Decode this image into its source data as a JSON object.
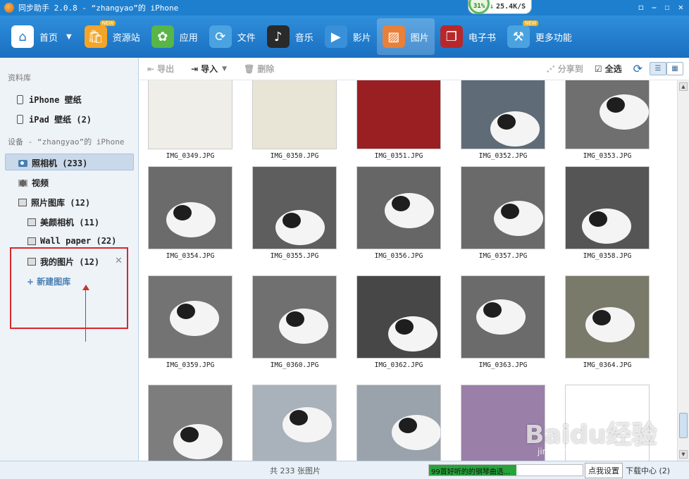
{
  "window": {
    "title": "同步助手 2.0.8 - “zhangyao”的 iPhone",
    "speed_percent": "31%",
    "speed_rate": "25.4K/S",
    "controls": [
      "◻",
      "⎯",
      "☐",
      "✕"
    ]
  },
  "nav": {
    "items": [
      {
        "label": "首页",
        "icon": "home-icon",
        "color": "#ffffff"
      },
      {
        "label": "资源站",
        "icon": "store-bag-icon",
        "color": "#f3a52a",
        "badge": "NEW"
      },
      {
        "label": "应用",
        "icon": "apps-icon",
        "color": "#58b548"
      },
      {
        "label": "文件",
        "icon": "folder-sync-icon",
        "color": "#4aa3e0"
      },
      {
        "label": "音乐",
        "icon": "music-note-icon",
        "color": "#2a2a2a"
      },
      {
        "label": "影片",
        "icon": "video-play-icon",
        "color": "#3a8fd9"
      },
      {
        "label": "图片",
        "icon": "picture-icon",
        "color": "#e8803a"
      },
      {
        "label": "电子书",
        "icon": "ebook-icon",
        "color": "#b8282a"
      },
      {
        "label": "更多功能",
        "icon": "tools-icon",
        "color": "#4aa3e0",
        "badge": "NEW"
      }
    ],
    "active_index": 6,
    "home_dropdown": "▼"
  },
  "sidebar": {
    "section_library": "资料库",
    "iphone_wallpaper": "iPhone 壁纸",
    "ipad_wallpaper": "iPad 壁纸 (2)",
    "section_device": "设备 - “zhangyao”的 iPhone",
    "camera_roll": "照相机 (233)",
    "video": "视频",
    "photo_library": "照片图库 (12)",
    "album_beauty": "美颜相机 (11)",
    "album_wallpaper": "Wall paper (22)",
    "album_mine": "我的图片 (12)",
    "new_album": "新建图库",
    "remove_icon": "✕"
  },
  "actions": {
    "export": "导出",
    "import": "导入",
    "delete": "删除",
    "share": "分享到",
    "select_all": "全选",
    "refresh_icon": "⟳"
  },
  "photos": [
    {
      "name": "IMG_0349.JPG",
      "bg": "#f0eee8"
    },
    {
      "name": "IMG_0350.JPG",
      "bg": "#e8e4d6"
    },
    {
      "name": "IMG_0351.JPG",
      "bg": "#9a1f22"
    },
    {
      "name": "IMG_0352.JPG",
      "bg": "#5f6b76"
    },
    {
      "name": "IMG_0353.JPG",
      "bg": "#6f6f6f"
    },
    {
      "name": "IMG_0354.JPG",
      "bg": "#6b6b6b"
    },
    {
      "name": "IMG_0355.JPG",
      "bg": "#5e5e5e"
    },
    {
      "name": "IMG_0356.JPG",
      "bg": "#666666"
    },
    {
      "name": "IMG_0357.JPG",
      "bg": "#6a6a6a"
    },
    {
      "name": "IMG_0358.JPG",
      "bg": "#555555"
    },
    {
      "name": "IMG_0359.JPG",
      "bg": "#737373"
    },
    {
      "name": "IMG_0360.JPG",
      "bg": "#707070"
    },
    {
      "name": "IMG_0362.JPG",
      "bg": "#474747"
    },
    {
      "name": "IMG_0363.JPG",
      "bg": "#6b6b6b"
    },
    {
      "name": "IMG_0364.JPG",
      "bg": "#7a7a6a"
    },
    {
      "name": "",
      "bg": "#7d7d7d"
    },
    {
      "name": "",
      "bg": "#a9b2ba"
    },
    {
      "name": "",
      "bg": "#9aa3ab"
    },
    {
      "name": "",
      "bg": "#9a7fa8"
    },
    {
      "name": "",
      "bg": "#ffffff"
    }
  ],
  "status": {
    "photo_count": "共 233 张图片",
    "music_title": "99首好听的的钢琴曲选...",
    "music_progress": 0.57,
    "click_set": "点我设置",
    "download_center": "下载中心 (2)"
  },
  "watermark": {
    "brand": "Baidu经验",
    "url": "jingyan.baidu.com"
  },
  "colors": {
    "accent": "#1f7fcf",
    "highlight_red": "#d9262a"
  }
}
